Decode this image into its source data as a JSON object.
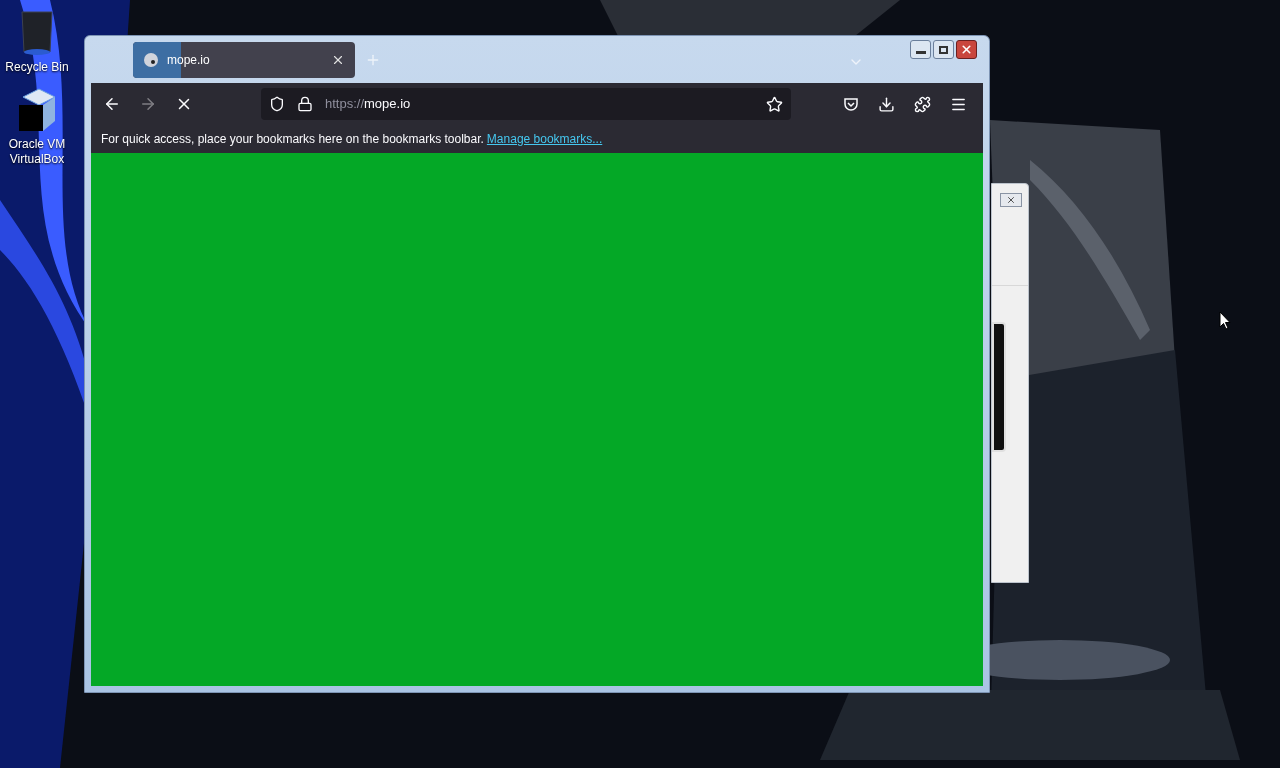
{
  "desktop": {
    "icons": [
      {
        "kind": "bin",
        "label": "Recycle Bin"
      },
      {
        "kind": "cube",
        "label": "Oracle VM VirtualBox"
      }
    ]
  },
  "browser": {
    "tabs": [
      {
        "title": "mope.io",
        "selected": true
      }
    ],
    "address": {
      "scheme": "https://",
      "host": "mope.io"
    },
    "loading": true,
    "bookmarks_bar": {
      "message": "For quick access, place your bookmarks here on the bookmarks toolbar.",
      "link": "Manage bookmarks..."
    }
  }
}
